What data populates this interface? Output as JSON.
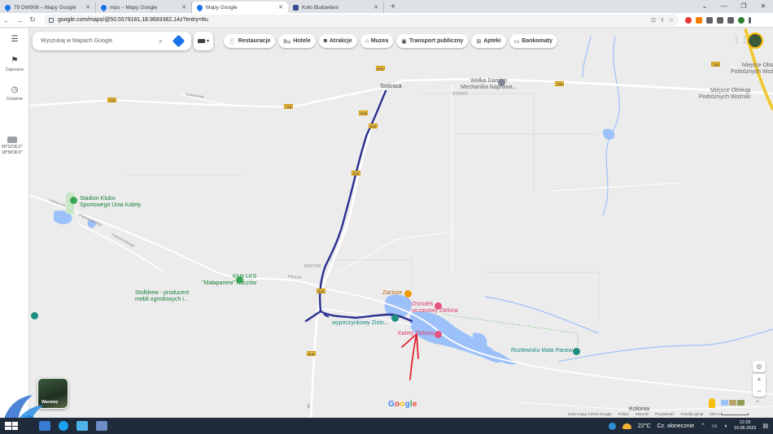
{
  "browser": {
    "tabs": [
      {
        "title": "79 DW908 – Mapy Google",
        "active": false
      },
      {
        "title": "mps – Mapy Google",
        "active": false
      },
      {
        "title": "Mapy Google",
        "active": true
      },
      {
        "title": "Koło Budowlani",
        "active": false
      }
    ],
    "url": "google.com/maps/@50.5579181,18.9693382,14z?entry=ttu"
  },
  "rail": {
    "saved_label": "Zapisane",
    "recent_label": "Ostatnie",
    "coords_line1": "50°32'30.2\"",
    "coords_line2": "18°58'36.5\""
  },
  "search": {
    "placeholder": "Wyszukaj w Mapach Google"
  },
  "chips": [
    {
      "icon": "restaurant-icon",
      "label": "Restauracje"
    },
    {
      "icon": "hotel-icon",
      "label": "Hotele"
    },
    {
      "icon": "camera-icon",
      "label": "Atrakcje"
    },
    {
      "icon": "museum-icon",
      "label": "Muzea"
    },
    {
      "icon": "transit-icon",
      "label": "Transport publiczny"
    },
    {
      "icon": "pharmacy-icon",
      "label": "Apteki"
    },
    {
      "icon": "atm-icon",
      "label": "Bankomaty"
    }
  ],
  "map": {
    "town_sosnica": "Sośnica",
    "wolka_line1": "Wolka Damian",
    "wolka_line2": "Mechanika Naprawa...",
    "dyrdy": "DYRDY",
    "stadion_line1": "Stadion Klubu",
    "stadion_line2": "Sportowego Unia Kalety",
    "klub_line1": "Klub LKS",
    "klub_line2": "\"Małapanew\" Kuczów",
    "stolldrew_line1": "Stolldrew - producent",
    "stolldrew_line2": "mebli ogrodowych i...",
    "miotek": "MIOTEK",
    "zaciszek": "Zacisze",
    "osrodek_line1": "Ośrodek",
    "osrodek_line2": "wczasowy Zielona",
    "wypocz": "wypoczynkowy Zielo...",
    "kalety": "Kalety Zielona",
    "rozlewisko": "Rozlewisko Mała Panew",
    "kolonia": "Kolonia",
    "miejsce1_line1": "Miejsce Obsługi",
    "miejsce1_line2": "Podróżnych Woźniki",
    "miejsce2_line1": "Miejsce Obsługi",
    "miejsce2_line2": "Podróżnych Woźniki",
    "road_shields": [
      "789",
      "789",
      "789",
      "908",
      "908",
      "908",
      "908",
      "908",
      "908",
      "789"
    ],
    "roads": {
      "kuleszowa": "Kuleszowa",
      "fabryczna": "Fabryczna",
      "paderewskiego": "Paderewskiego",
      "paderewskiego2": "Paderewskiego",
      "sportowa": "Pstrąski",
      "plk": "Plk"
    }
  },
  "layers_label": "Warstwy",
  "footer": {
    "data": "Dane mapy ©2023 Google",
    "polska": "Polska",
    "warunki": "Warunki",
    "prywatnosc": "Prywatność",
    "opinia": "Prześlij opinię",
    "scale": "500 m"
  },
  "taskbar": {
    "temperature": "22°C",
    "weather": "Cz. słonecznie",
    "time": "12:29",
    "date": "10.06.2023"
  },
  "colors": {
    "route": "#2b2f8f",
    "arrow": "#e0212f",
    "water": "#9cc0f9",
    "road": "#ffffff",
    "highway": "#f4d03f"
  }
}
